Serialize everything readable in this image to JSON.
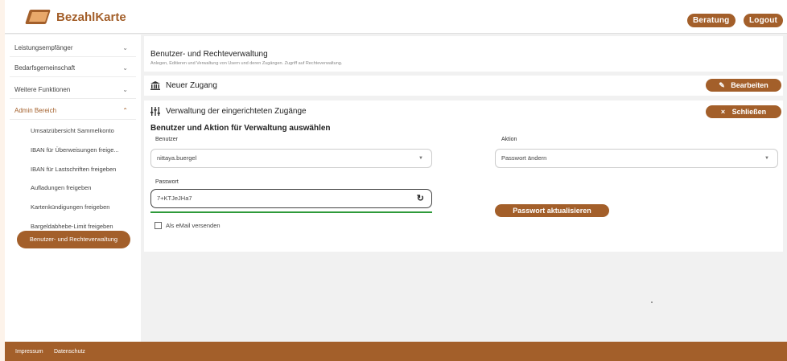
{
  "app": {
    "name": "BezahlKarte"
  },
  "header": {
    "beratung": "Beratung",
    "logout": "Logout"
  },
  "sidebar": {
    "items": [
      {
        "label": "Leistungsempfänger"
      },
      {
        "label": "Bedarfsgemeinschaft"
      },
      {
        "label": "Weitere Funktionen"
      },
      {
        "label": "Admin Bereich"
      }
    ],
    "admin_sub": [
      {
        "label": "Umsatzübersicht Sammelkonto"
      },
      {
        "label": "IBAN für Überweisungen freige..."
      },
      {
        "label": "IBAN für Lastschriften freigeben"
      },
      {
        "label": "Aufladungen freigeben"
      },
      {
        "label": "Kartenkündigungen freigeben"
      },
      {
        "label": "Bargeldabhebe-Limit freigeben"
      },
      {
        "label": "Benutzer- und Rechteverwaltung"
      }
    ]
  },
  "page": {
    "title": "Benutzer- und Rechteverwaltung",
    "subtitle": "Anlegen, Editieren und Verwaltung von Usern und deren Zugängen. Zugriff auf Rechteverwaltung."
  },
  "neuer_zugang": {
    "title": "Neuer Zugang",
    "button": "Bearbeiten"
  },
  "verwaltung": {
    "title": "Verwaltung der eingerichteten Zugänge",
    "close_button": "Schließen",
    "section_title": "Benutzer und Aktion für Verwaltung auswählen",
    "benutzer_label": "Benutzer",
    "benutzer_value": "nittaya.buergel",
    "aktion_label": "Aktion",
    "aktion_value": "Passwort ändern",
    "passwort_label": "Passwort",
    "passwort_value": "7+KTJeJHa7",
    "update_button": "Passwort aktualisieren",
    "email_checkbox_label": "Als eMail versenden"
  },
  "footer": {
    "impressum": "Impressum",
    "datenschutz": "Datenschutz"
  },
  "colors": {
    "accent": "#a35f2a",
    "success": "#2e9a3a"
  }
}
